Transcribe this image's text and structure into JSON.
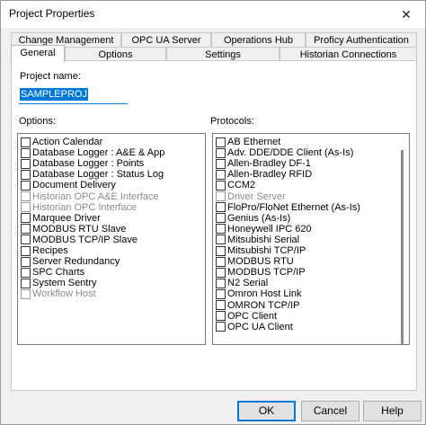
{
  "window": {
    "title": "Project Properties",
    "close_glyph": "✕"
  },
  "tabs_back": [
    {
      "label": "Change Management"
    },
    {
      "label": "OPC UA Server"
    },
    {
      "label": "Operations Hub"
    },
    {
      "label": "Proficy Authentication"
    }
  ],
  "tabs_front": [
    {
      "label": "General",
      "active": true
    },
    {
      "label": "Options"
    },
    {
      "label": "Settings"
    },
    {
      "label": "Historian Connections"
    }
  ],
  "general": {
    "project_name_label": "Project name:",
    "project_name_value": "SAMPLEPROJ",
    "options_label": "Options:",
    "protocols_label": "Protocols:"
  },
  "options": [
    {
      "label": "Action Calendar",
      "enabled": true,
      "checked": false
    },
    {
      "label": "Database Logger : A&E & App",
      "enabled": true,
      "checked": false
    },
    {
      "label": "Database Logger : Points",
      "enabled": true,
      "checked": false
    },
    {
      "label": "Database Logger : Status Log",
      "enabled": true,
      "checked": false
    },
    {
      "label": "Document Delivery",
      "enabled": true,
      "checked": false
    },
    {
      "label": "Historian OPC A&E Interface",
      "enabled": false,
      "checked": false
    },
    {
      "label": "Historian OPC Interface",
      "enabled": false,
      "checked": false
    },
    {
      "label": "Marquee Driver",
      "enabled": true,
      "checked": false
    },
    {
      "label": "MODBUS RTU Slave",
      "enabled": true,
      "checked": false
    },
    {
      "label": "MODBUS TCP/IP Slave",
      "enabled": true,
      "checked": false
    },
    {
      "label": "Recipes",
      "enabled": true,
      "checked": false
    },
    {
      "label": "Server Redundancy",
      "enabled": true,
      "checked": false
    },
    {
      "label": "SPC Charts",
      "enabled": true,
      "checked": false
    },
    {
      "label": "System Sentry",
      "enabled": true,
      "checked": false
    },
    {
      "label": "Workflow Host",
      "enabled": false,
      "checked": false
    }
  ],
  "protocols": [
    {
      "label": "AB Ethernet",
      "enabled": true,
      "checked": false
    },
    {
      "label": "Adv. DDE/DDE Client (As-Is)",
      "enabled": true,
      "checked": false
    },
    {
      "label": "Allen-Bradley DF-1",
      "enabled": true,
      "checked": false
    },
    {
      "label": "Allen-Bradley RFID",
      "enabled": true,
      "checked": false
    },
    {
      "label": "CCM2",
      "enabled": true,
      "checked": false
    },
    {
      "label": "Driver Server",
      "enabled": false,
      "checked": false
    },
    {
      "label": "FloPro/FloNet Ethernet (As-Is)",
      "enabled": true,
      "checked": false
    },
    {
      "label": "Genius (As-Is)",
      "enabled": true,
      "checked": false
    },
    {
      "label": "Honeywell IPC 620",
      "enabled": true,
      "checked": false
    },
    {
      "label": "Mitsubishi Serial",
      "enabled": true,
      "checked": false
    },
    {
      "label": "Mitsubishi TCP/IP",
      "enabled": true,
      "checked": false
    },
    {
      "label": "MODBUS RTU",
      "enabled": true,
      "checked": false
    },
    {
      "label": "MODBUS TCP/IP",
      "enabled": true,
      "checked": false
    },
    {
      "label": "N2 Serial",
      "enabled": true,
      "checked": false
    },
    {
      "label": "Omron Host Link",
      "enabled": true,
      "checked": false
    },
    {
      "label": "OMRON TCP/IP",
      "enabled": true,
      "checked": false
    },
    {
      "label": "OPC Client",
      "enabled": true,
      "checked": false
    },
    {
      "label": "OPC UA Client",
      "enabled": true,
      "checked": false
    }
  ],
  "buttons": {
    "ok": "OK",
    "cancel": "Cancel",
    "help": "Help"
  }
}
